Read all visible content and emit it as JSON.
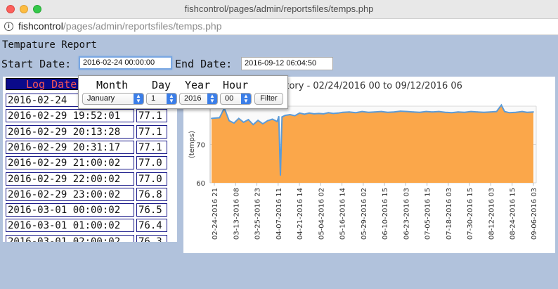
{
  "window": {
    "title": "fishcontrol/pages/admin/reportsfiles/temps.php"
  },
  "address_bar": {
    "host": "fishcontrol",
    "path": "/pages/admin/reportsfiles/temps.php",
    "info_icon": "info-icon"
  },
  "page": {
    "title": "Tempature Report",
    "start_label": "Start Date:",
    "start_value": "2016-02-24 00:00:00",
    "end_label": "End Date:",
    "end_value": "2016-09-12 06:04:50"
  },
  "filter_popup": {
    "month_label": "Month",
    "day_label": "Day",
    "year_label": "Year",
    "hour_label": "Hour",
    "month_value": "January",
    "day_value": "1",
    "year_value": "2016",
    "hour_value": "00",
    "filter_button": "Filter"
  },
  "log_table": {
    "header": "Log Date",
    "rows": [
      {
        "date": "2016-02-24",
        "temp": ""
      },
      {
        "date": "2016-02-29 19:52:01",
        "temp": "77.1"
      },
      {
        "date": "2016-02-29 20:13:28",
        "temp": "77.1"
      },
      {
        "date": "2016-02-29 20:31:17",
        "temp": "77.1"
      },
      {
        "date": "2016-02-29 21:00:02",
        "temp": "77.0"
      },
      {
        "date": "2016-02-29 22:00:02",
        "temp": "77.0"
      },
      {
        "date": "2016-02-29 23:00:02",
        "temp": "76.8"
      },
      {
        "date": "2016-03-01 00:00:02",
        "temp": "76.5"
      },
      {
        "date": "2016-03-01 01:00:02",
        "temp": "76.4"
      },
      {
        "date": "2016-03-01 02:00:02",
        "temp": "76.3"
      }
    ]
  },
  "colors": {
    "page_bg": "#b1c2dc",
    "header_bg": "#0a0a8a",
    "header_text": "#f45555",
    "area_fill": "#fba74a",
    "line": "#5b9bd8",
    "select_arrow": "#3b7ee8"
  },
  "chart_data": {
    "type": "area",
    "title": "re History - 02/24/2016 00 to 09/12/2016 06",
    "ylabel": "(temps)",
    "xlabel": "",
    "ylim": [
      60,
      80
    ],
    "yticks": [
      "60",
      "70",
      "80"
    ],
    "grid": true,
    "x_tick_labels": [
      "02-24-2016 21",
      "03-13-2016 08",
      "03-25-2016 23",
      "04-07-2016 11",
      "04-21-2016 14",
      "05-04-2016 02",
      "05-16-2016 14",
      "05-29-2016 02",
      "06-10-2016 15",
      "06-23-2016 03",
      "07-05-2016 15",
      "07-18-2016 03",
      "07-30-2016 15",
      "08-12-2016 03",
      "08-24-2016 15",
      "09-06-2016 03"
    ],
    "series": [
      {
        "x": [
          "02-24",
          "02-29",
          "03-03",
          "03-06",
          "03-09",
          "03-12",
          "03-15",
          "03-18",
          "03-21",
          "03-24",
          "03-27",
          "03-30",
          "04-02",
          "04-05",
          "04-06",
          "04-07",
          "04-08",
          "04-10",
          "04-13",
          "04-16",
          "04-19",
          "04-22",
          "04-25",
          "04-28",
          "05-01",
          "05-04",
          "05-07",
          "05-10",
          "05-13",
          "05-16",
          "05-20",
          "05-24",
          "05-28",
          "06-01",
          "06-05",
          "06-09",
          "06-13",
          "06-17",
          "06-21",
          "06-25",
          "06-29",
          "07-03",
          "07-07",
          "07-11",
          "07-15",
          "07-19",
          "07-23",
          "07-27",
          "07-31",
          "08-04",
          "08-08",
          "08-12",
          "08-16",
          "08-20",
          "08-23",
          "08-25",
          "08-28",
          "09-01",
          "09-05",
          "09-08",
          "09-12"
        ],
        "values": [
          76.8,
          77.0,
          79.5,
          76.2,
          75.6,
          76.8,
          75.8,
          76.5,
          75.2,
          76.3,
          75.4,
          76.2,
          76.6,
          76.0,
          77.3,
          62.0,
          77.2,
          77.6,
          77.8,
          77.5,
          78.2,
          77.9,
          78.2,
          78.0,
          78.1,
          78.0,
          78.3,
          78.1,
          78.2,
          78.4,
          78.5,
          78.3,
          78.6,
          78.4,
          78.5,
          78.6,
          78.4,
          78.5,
          78.7,
          78.6,
          78.5,
          78.4,
          78.6,
          78.5,
          78.6,
          78.4,
          78.3,
          78.5,
          78.4,
          78.6,
          78.5,
          78.4,
          78.5,
          78.6,
          80.3,
          78.6,
          78.3,
          78.4,
          78.6,
          78.4,
          78.5
        ]
      }
    ]
  }
}
